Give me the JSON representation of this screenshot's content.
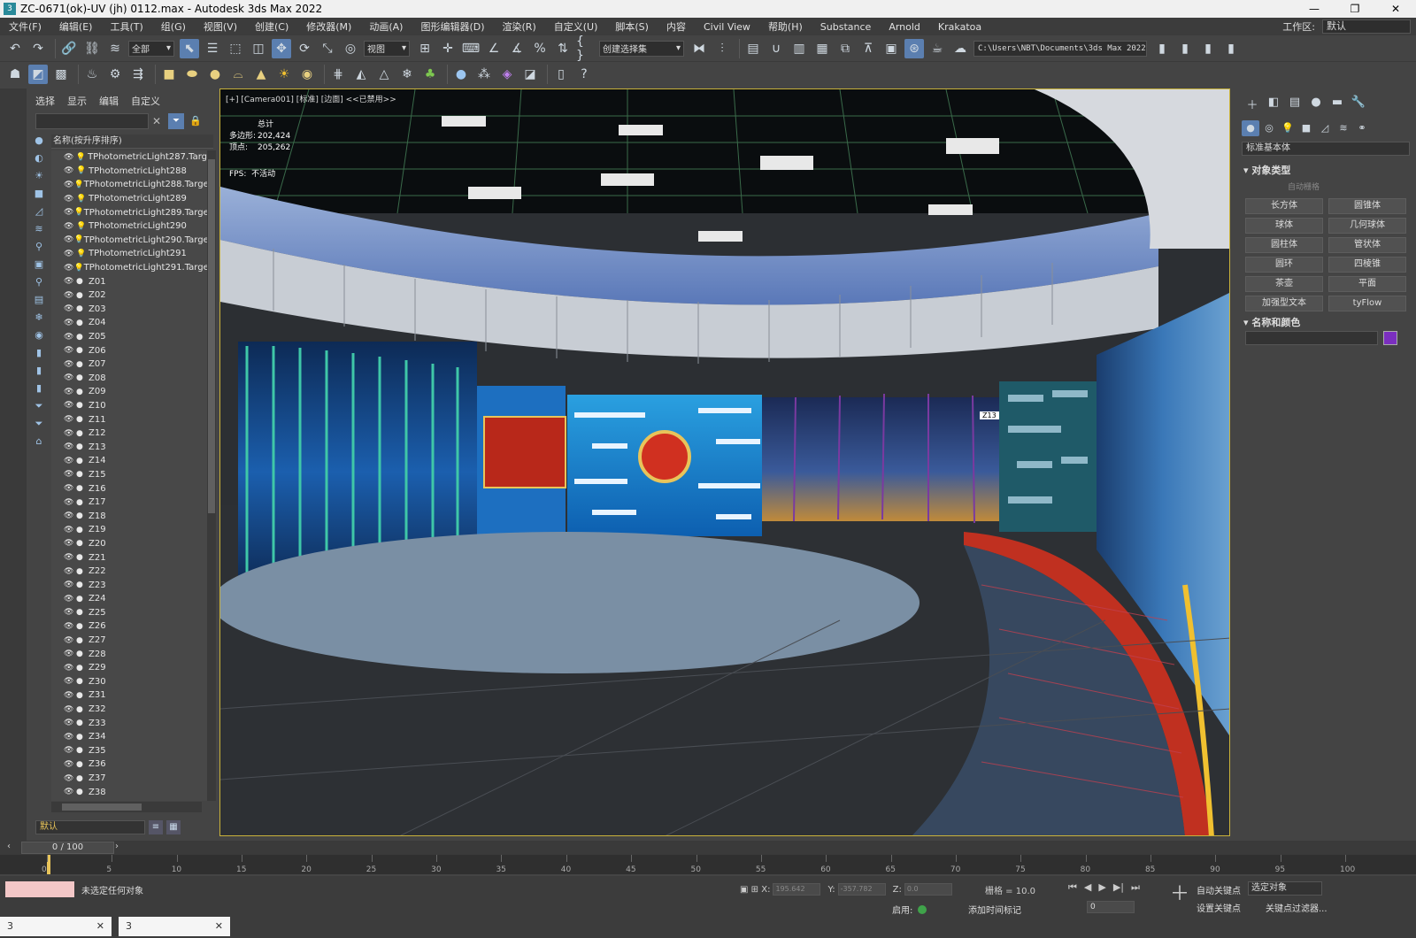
{
  "window": {
    "title": "ZC-0671(ok)-UV (jh) 0112.max - Autodesk 3ds Max 2022",
    "icon": "3",
    "minimize": "—",
    "restore": "❐",
    "close": "✕"
  },
  "menu": {
    "items": [
      "文件(F)",
      "编辑(E)",
      "工具(T)",
      "组(G)",
      "视图(V)",
      "创建(C)",
      "修改器(M)",
      "动画(A)",
      "图形编辑器(D)",
      "渲染(R)",
      "自定义(U)",
      "脚本(S)",
      "内容",
      "Civil View",
      "帮助(H)",
      "Substance",
      "Arnold",
      "Krakatoa"
    ],
    "workspace_label": "工作区:",
    "workspace_value": "默认"
  },
  "toolbar1": {
    "selection_filter": "全部",
    "reference_coord": "视图",
    "named_selection": "创建选择集",
    "project_path": "C:\\Users\\NBT\\Documents\\3ds Max 2022"
  },
  "scene_explorer": {
    "tabs": [
      "选择",
      "显示",
      "编辑",
      "自定义"
    ],
    "header": "名称(按升序排序)",
    "search_placeholder": "",
    "objects": [
      "TPhotometricLight287.Targ",
      "TPhotometricLight288",
      "TPhotometricLight288.Targe",
      "TPhotometricLight289",
      "TPhotometricLight289.Targe",
      "TPhotometricLight290",
      "TPhotometricLight290.Targe",
      "TPhotometricLight291",
      "TPhotometricLight291.Targe",
      "Z01",
      "Z02",
      "Z03",
      "Z04",
      "Z05",
      "Z06",
      "Z07",
      "Z08",
      "Z09",
      "Z10",
      "Z11",
      "Z12",
      "Z13",
      "Z14",
      "Z15",
      "Z16",
      "Z17",
      "Z18",
      "Z19",
      "Z20",
      "Z21",
      "Z22",
      "Z23",
      "Z24",
      "Z25",
      "Z26",
      "Z27",
      "Z28",
      "Z29",
      "Z30",
      "Z31",
      "Z32",
      "Z33",
      "Z34",
      "Z35",
      "Z36",
      "Z37",
      "Z38"
    ],
    "layer": "默认"
  },
  "viewport": {
    "label": "[+] [Camera001] [标准] [边面] <<已禁用>>",
    "stats_title": "总计",
    "polys_label": "多边形:",
    "polys_value": "202,424",
    "verts_label": "顶点:",
    "verts_value": "205,262",
    "fps_label": "FPS:",
    "fps_value": "不活动",
    "object_label": "Z13"
  },
  "command_panel": {
    "category": "标准基本体",
    "object_type_title": "对象类型",
    "auto_grid": "自动栅格",
    "buttons": [
      "长方体",
      "圆锥体",
      "球体",
      "几何球体",
      "圆柱体",
      "管状体",
      "圆环",
      "四棱锥",
      "茶壶",
      "平面",
      "加强型文本",
      "tyFlow"
    ],
    "name_color_title": "名称和颜色",
    "object_color": "#7b2fbf"
  },
  "timeline": {
    "frame_display": "0 / 100",
    "ticks": [
      "0",
      "5",
      "10",
      "15",
      "20",
      "25",
      "30",
      "35",
      "40",
      "45",
      "50",
      "55",
      "60",
      "65",
      "70",
      "75",
      "80",
      "85",
      "90",
      "95",
      "100"
    ]
  },
  "status": {
    "message": "未选定任何对象",
    "x_label": "X:",
    "x_value": "195.642",
    "y_label": "Y:",
    "y_value": "-357.782",
    "z_label": "Z:",
    "z_value": "0.0",
    "grid": "栅格 = 10.0",
    "auto_key": "自动关键点",
    "set_key": "设置关键点",
    "selected_object": "选定对象",
    "key_filters": "关键点过滤器...",
    "enable": "启用:",
    "add_time_tag": "添加时间标记",
    "frame_value": "0"
  }
}
